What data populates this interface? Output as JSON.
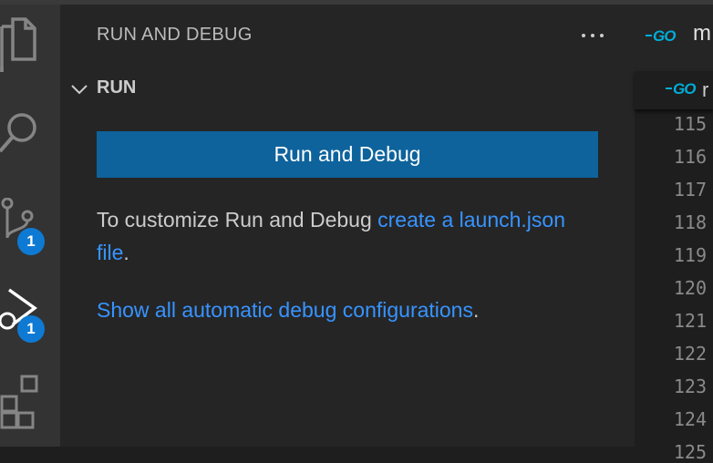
{
  "activity_bar": {
    "scm_badge": "1",
    "debug_badge": "1"
  },
  "sidebar": {
    "title": "RUN AND DEBUG",
    "section": "RUN",
    "run_button_label": "Run and Debug",
    "customize_text": "To customize Run and Debug ",
    "customize_link": "create a launch.json file",
    "customize_end": ".",
    "show_configs_link": "Show all automatic debug configurations",
    "show_configs_end": "."
  },
  "editor": {
    "tab_logo": "GO",
    "tab_name": "m",
    "breadcrumb_logo": "GO",
    "breadcrumb_name": "r",
    "line_numbers": [
      "115",
      "116",
      "117",
      "118",
      "119",
      "120",
      "121",
      "122",
      "123",
      "124",
      "125"
    ]
  },
  "colors": {
    "accent": "#0e639c",
    "link": "#3794ff",
    "badge": "#0e7ad3",
    "go": "#00add8"
  }
}
